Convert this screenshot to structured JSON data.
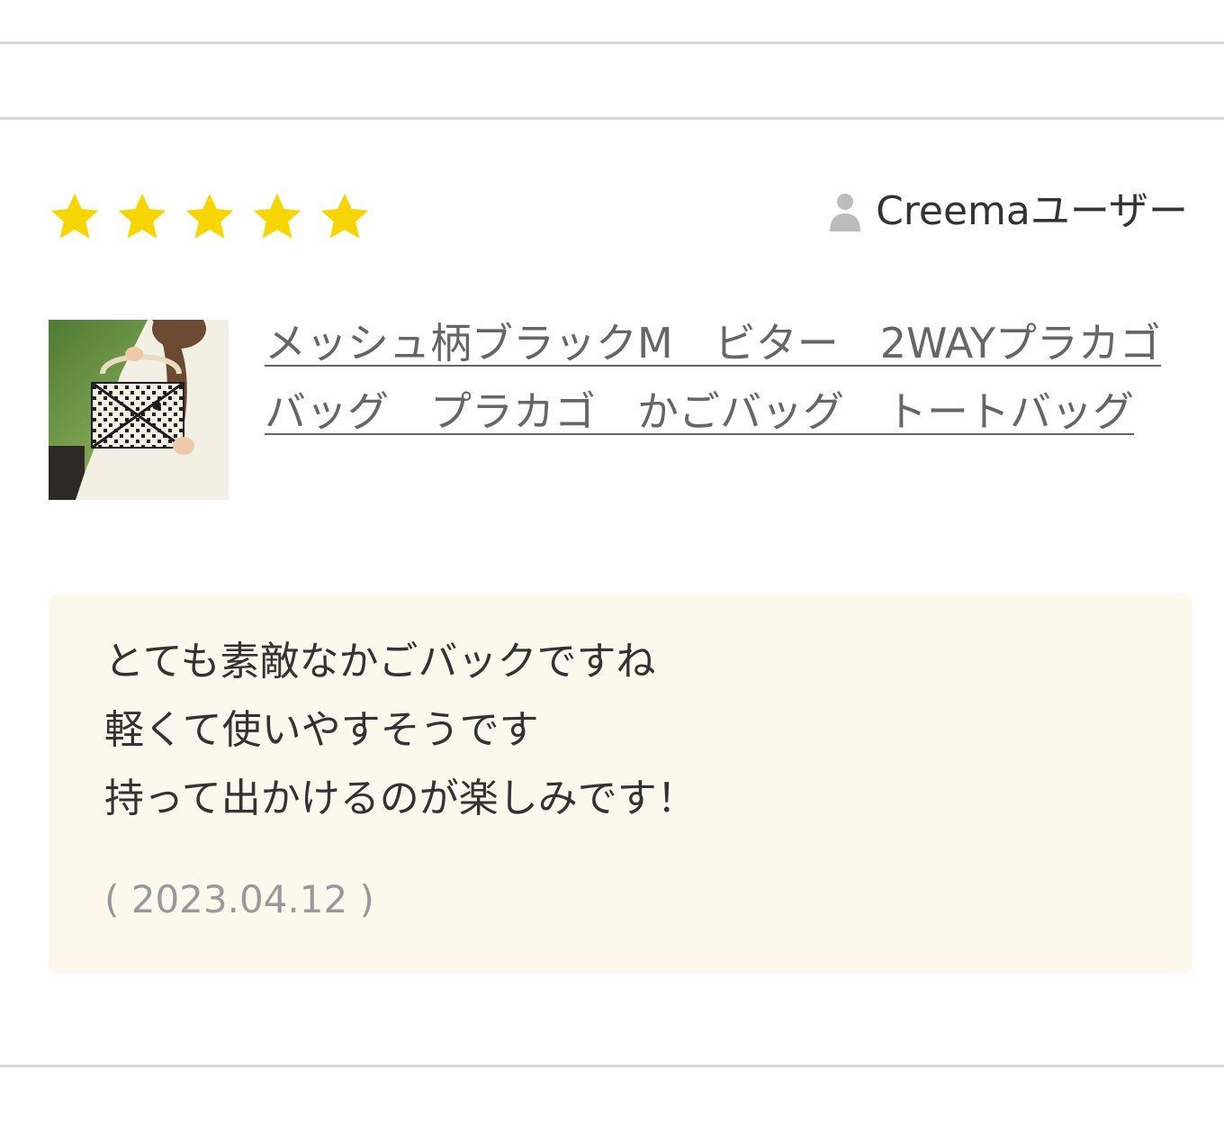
{
  "review": {
    "rating": 5,
    "max_rating": 5,
    "star_color": "#f7d500",
    "user_name": "Creemaユーザー",
    "product": {
      "title": "メッシュ柄ブラックM　ビター　2WAYプラカゴバッグ　プラカゴ　かごバッグ　トートバッグ"
    },
    "comment_lines": [
      "とても素敵なかごバックですね",
      "軽くて使いやすそうです",
      "持って出かけるのが楽しみです！"
    ],
    "date": "( 2023.04.12 )"
  },
  "icons": {
    "star": "star-icon",
    "user": "user-icon"
  },
  "colors": {
    "comment_background": "#fcf8ee",
    "divider": "#d6d6d6",
    "link_text": "#666666",
    "date_text": "#999999"
  }
}
